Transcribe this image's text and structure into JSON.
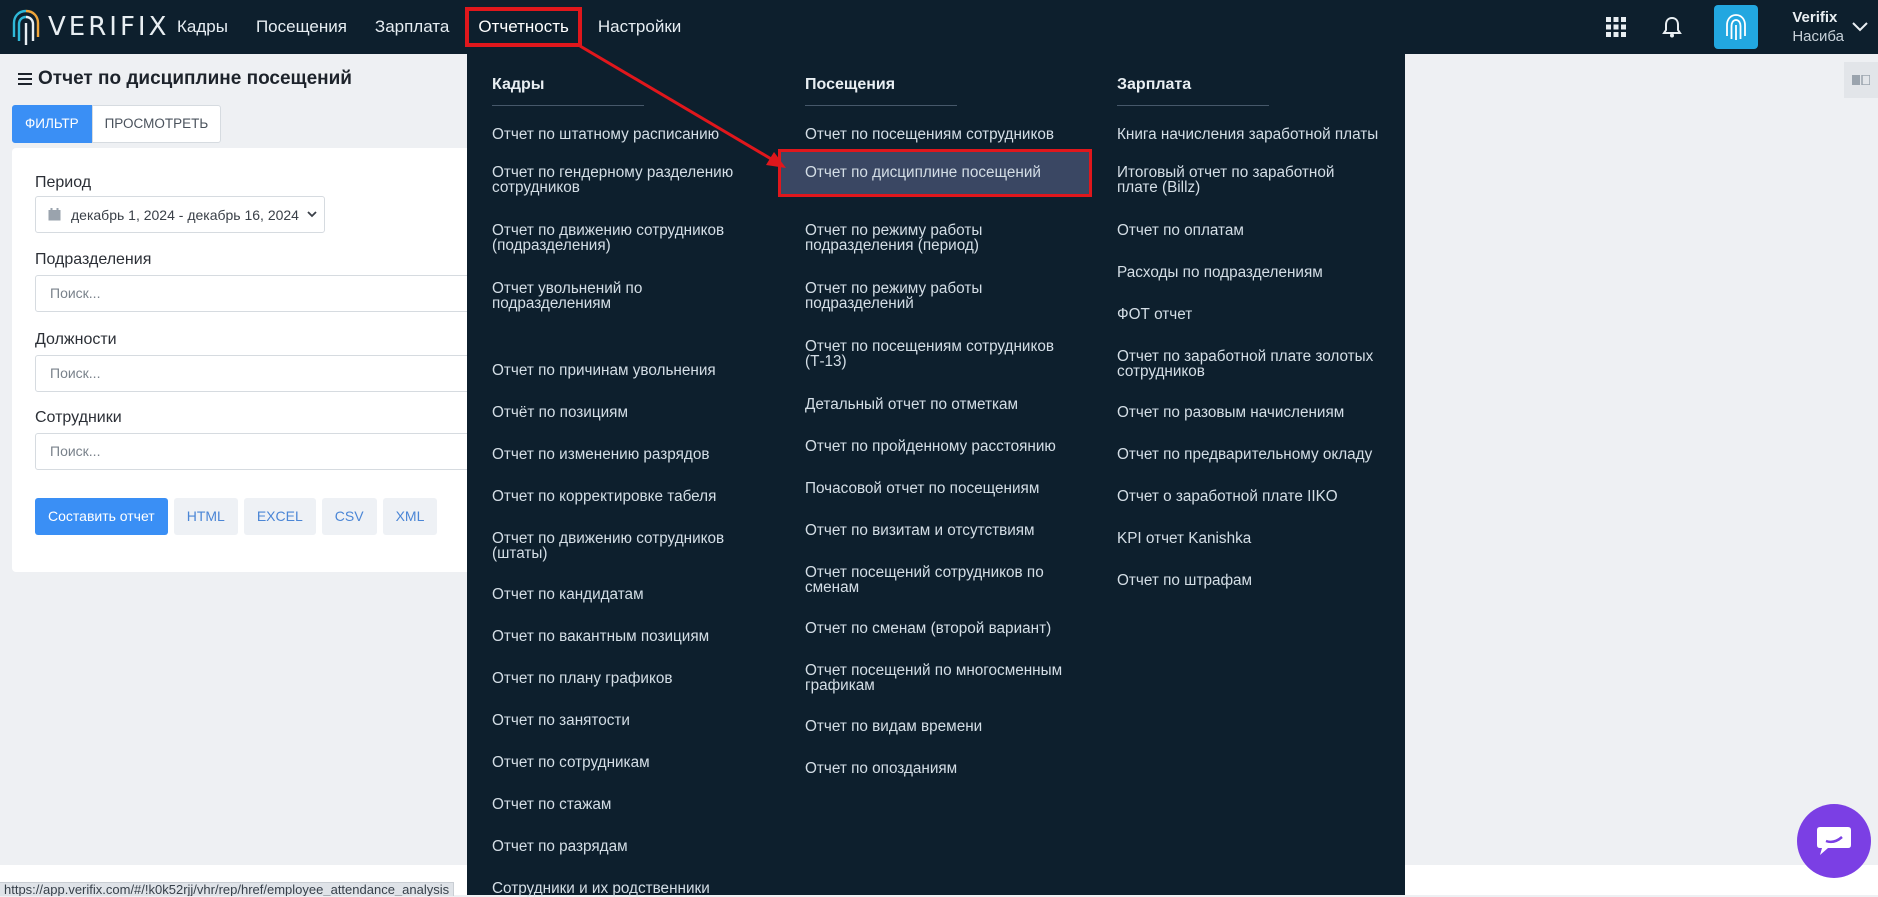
{
  "app": {
    "brand": "VERIFIX",
    "nav": [
      {
        "label": "Кадры"
      },
      {
        "label": "Посещения"
      },
      {
        "label": "Зарплата"
      },
      {
        "label": "Отчетность"
      },
      {
        "label": "Настройки"
      }
    ],
    "active_nav": "Отчетность",
    "user": {
      "name": "Verifix",
      "subtitle": "Насиба"
    },
    "colors": {
      "topbar": "#0d1f2d",
      "accent": "#3a8ff5",
      "highlight_box": "#e0171c",
      "chat": "#7b3fe4"
    }
  },
  "page": {
    "title": "Отчет по дисциплине посещений",
    "tabs": [
      {
        "label": "ФИЛЬТР"
      },
      {
        "label": "ПРОСМОТРЕТЬ"
      }
    ],
    "filters": {
      "period_label": "Период",
      "period_value": "декабрь 1, 2024 - декабрь 16, 2024",
      "divisions_label": "Подразделения",
      "positions_label": "Должности",
      "employees_label": "Сотрудники",
      "search_placeholder": "Поиск..."
    },
    "actions": {
      "build": "Составить отчет",
      "html": "HTML",
      "excel": "EXCEL",
      "csv": "CSV",
      "xml": "XML"
    }
  },
  "dropdown": {
    "columns": [
      {
        "heading": "Кадры",
        "items": [
          [
            "Отчет по штатному расписанию"
          ],
          [
            "Отчет по гендерному разделению",
            "сотрудников"
          ],
          [
            "Отчет по движению сотрудников",
            "(подразделения)"
          ],
          [
            "Отчет увольнений по",
            "подразделениям"
          ],
          [
            "Отчет по причинам увольнения"
          ],
          [
            "Отчёт по позициям"
          ],
          [
            "Отчет по изменению разрядов"
          ],
          [
            "Отчет по корректировке табеля"
          ],
          [
            "Отчет по движению сотрудников",
            "(штаты)"
          ],
          [
            "Отчет по кандидатам"
          ],
          [
            "Отчет по вакантным позициям"
          ],
          [
            "Отчет по плану графиков"
          ],
          [
            "Отчет по занятости"
          ],
          [
            "Отчет по сотрудникам"
          ],
          [
            "Отчет по стажам"
          ],
          [
            "Отчет по разрядам"
          ],
          [
            "Сотрудники и их родственники"
          ]
        ]
      },
      {
        "heading": "Посещения",
        "items": [
          [
            "Отчет по посещениям сотрудников"
          ],
          [
            "Отчет по дисциплине посещений"
          ],
          [
            "Отчет по режиму работы",
            "подразделения (период)"
          ],
          [
            "Отчет по режиму работы",
            "подразделений"
          ],
          [
            "Отчет по посещениям сотрудников",
            "(Т-13)"
          ],
          [
            "Детальный отчет по отметкам"
          ],
          [
            "Отчет по пройденному расстоянию"
          ],
          [
            "Почасовой отчет по посещениям"
          ],
          [
            "Отчет по визитам и отсутствиям"
          ],
          [
            "Отчет посещений сотрудников по",
            "сменам"
          ],
          [
            "Отчет по сменам (второй вариант)"
          ],
          [
            "Отчет посещений по многосменным",
            "графикам"
          ],
          [
            "Отчет по видам времени"
          ],
          [
            "Отчет по опозданиям"
          ]
        ]
      },
      {
        "heading": "Зарплата",
        "items": [
          [
            "Книга начисления заработной платы"
          ],
          [
            "Итоговый отчет по заработной",
            "плате (Billz)"
          ],
          [
            "Отчет по оплатам"
          ],
          [
            "Расходы по подразделениям"
          ],
          [
            "ФОТ отчет"
          ],
          [
            "Отчет по заработной плате золотых",
            "сотрудников"
          ],
          [
            "Отчет по разовым начислениям"
          ],
          [
            "Отчет по предварительному окладу"
          ],
          [
            "Отчет о заработной плате IIKO"
          ],
          [
            "KPI отчет Kanishka"
          ],
          [
            "Отчет по штрафам"
          ]
        ]
      }
    ],
    "highlighted": "Отчет по дисциплине посещений"
  },
  "statusbar": {
    "url": "https://app.verifix.com/#/!k0k52rjj/vhr/rep/href/employee_attendance_analysis"
  },
  "icons": [
    "fingerprint-logo-icon",
    "apps-grid-icon",
    "bell-icon",
    "fingerprint-avatar-icon",
    "chevron-down-icon",
    "hamburger-icon",
    "calendar-icon",
    "chat-icon",
    "translate-icon"
  ]
}
